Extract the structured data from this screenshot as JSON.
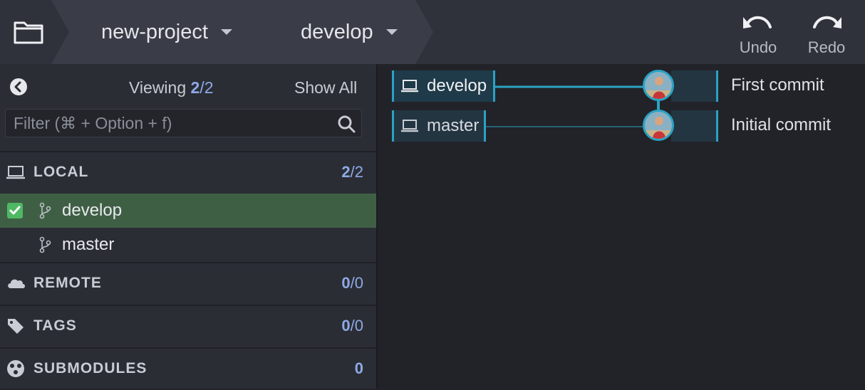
{
  "toolbar": {
    "repo_name": "new-project",
    "branch_name": "develop",
    "undo_label": "Undo",
    "redo_label": "Redo"
  },
  "sidebar": {
    "viewing_label": "Viewing",
    "viewing_count": "2",
    "viewing_total": "/2",
    "show_all_label": "Show All",
    "filter_placeholder": "Filter (⌘ + Option + f)",
    "sections": {
      "local": {
        "title": "LOCAL",
        "count": "2",
        "total": "/2"
      },
      "remote": {
        "title": "REMOTE",
        "count": "0",
        "total": "/0"
      },
      "tags": {
        "title": "TAGS",
        "count": "0",
        "total": "/0"
      },
      "submodules": {
        "title": "SUBMODULES",
        "count": "0"
      }
    },
    "local_branches": [
      {
        "name": "develop",
        "checked_out": true
      },
      {
        "name": "master",
        "checked_out": false
      }
    ]
  },
  "graph": {
    "commits": [
      {
        "ref": "develop",
        "message": "First commit"
      },
      {
        "ref": "master",
        "message": "Initial commit"
      }
    ]
  },
  "colors": {
    "accent": "#2aa3c4",
    "active_branch_bg": "#3f5f44",
    "count_blue": "#8ea9e6",
    "check_green": "#4fb865"
  },
  "icons": [
    "folder-icon",
    "undo-icon",
    "redo-icon",
    "back-icon",
    "search-icon",
    "laptop-icon",
    "branch-icon",
    "cloud-icon",
    "tag-icon",
    "submodule-icon",
    "checkmark-icon"
  ]
}
